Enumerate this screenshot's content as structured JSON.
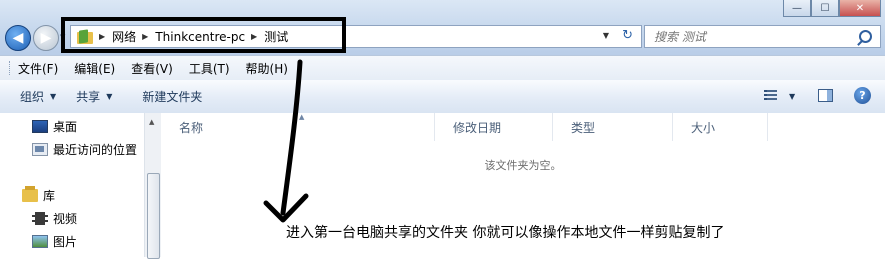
{
  "window": {
    "minimize_label": "—",
    "maximize_label": "☐",
    "close_label": "✕"
  },
  "address_bar": {
    "breadcrumbs": [
      "网络",
      "Thinkcentre-pc",
      "测试"
    ],
    "refresh_label": "↻"
  },
  "search": {
    "placeholder": "搜索 测试"
  },
  "menu": {
    "items": [
      "文件(F)",
      "编辑(E)",
      "查看(V)",
      "工具(T)",
      "帮助(H)"
    ]
  },
  "commandbar": {
    "organize": "组织",
    "share": "共享",
    "new_folder": "新建文件夹"
  },
  "nav_pane": {
    "items": [
      {
        "label": "桌面",
        "icon": "desktop-icon"
      },
      {
        "label": "最近访问的位置",
        "icon": "recent-places-icon"
      },
      {
        "label": "库",
        "icon": "library-icon"
      },
      {
        "label": "视频",
        "icon": "video-library-icon"
      },
      {
        "label": "图片",
        "icon": "pictures-library-icon"
      }
    ]
  },
  "file_list": {
    "columns": [
      "名称",
      "修改日期",
      "类型",
      "大小"
    ],
    "empty_message": "该文件夹为空。"
  },
  "annotation": {
    "text": "进入第一台电脑共享的文件夹  你就可以像操作本地文件一样剪贴复制了",
    "highlight_color": "#000000",
    "arrow_color": "#000000"
  }
}
